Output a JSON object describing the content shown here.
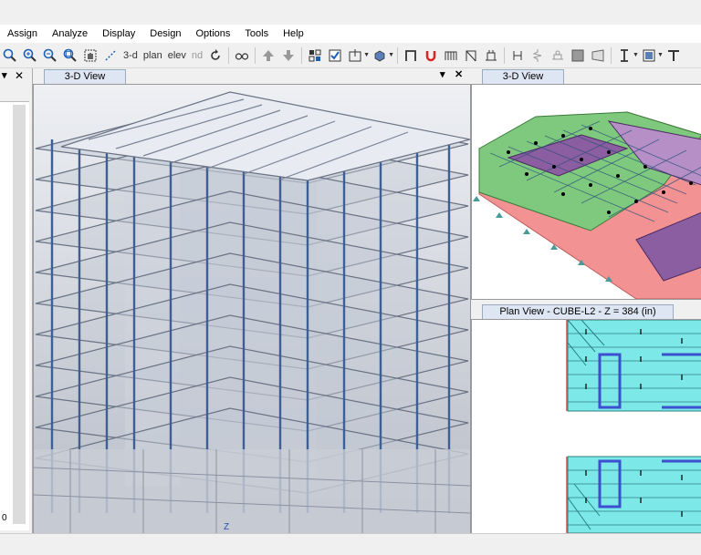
{
  "menu": [
    "Assign",
    "Analyze",
    "Display",
    "Design",
    "Options",
    "Tools",
    "Help"
  ],
  "toolbar": {
    "view_3d_label": "3-d",
    "plan_label": "plan",
    "elev_label": "elev",
    "nd_label": "nd"
  },
  "views": {
    "main": {
      "title": "3-D View"
    },
    "top_right": {
      "title": "3-D View"
    },
    "bottom_right": {
      "title": "Plan View - CUBE-L2 - Z = 384 (in)"
    }
  },
  "left_panel": {
    "bottom_label": "0"
  },
  "colors": {
    "slab_green": "#7fc97f",
    "slab_purple": "#8a5ea0",
    "wall_red": "#f08080",
    "plan_cyan": "#7de8e8",
    "beam_blue": "#3b4fcf"
  }
}
